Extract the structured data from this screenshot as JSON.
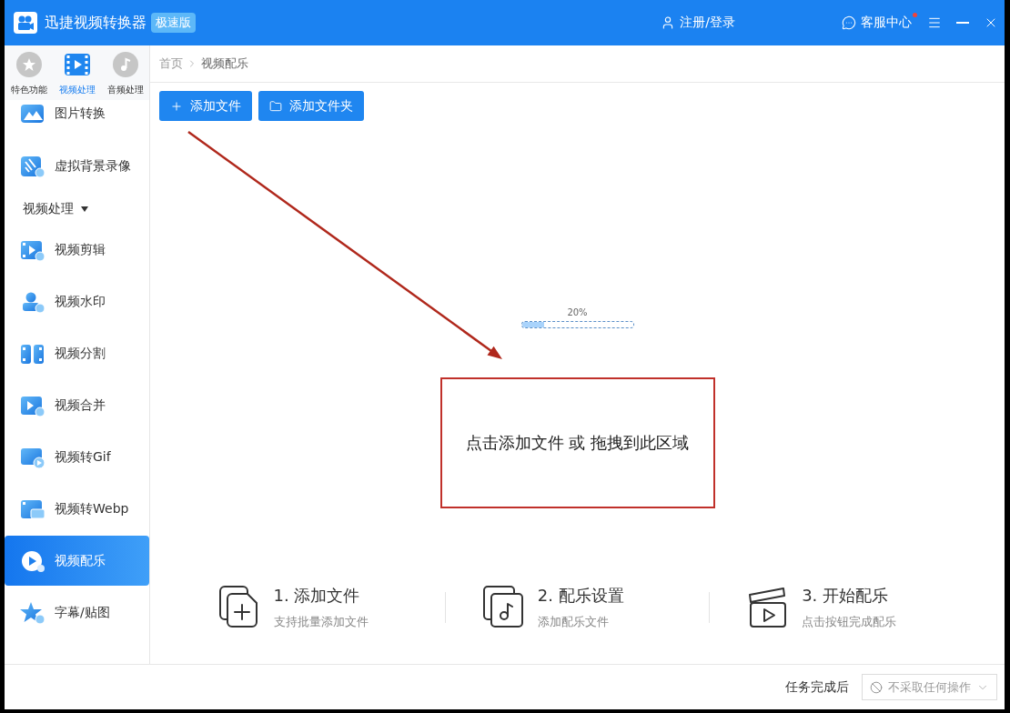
{
  "window": {
    "title": "迅捷视频转换器",
    "badge": "极速版"
  },
  "header": {
    "account": "注册/登录",
    "service": {
      "label": "客服中心",
      "notification": true
    }
  },
  "sidebar": {
    "tabs": [
      {
        "label": "特色功能",
        "selected": false
      },
      {
        "label": "视频处理",
        "selected": true
      },
      {
        "label": "音频处理",
        "selected": false
      }
    ],
    "groups": [
      {
        "items": [
          {
            "label": "图片转换",
            "selected": false
          },
          {
            "label": "虚拟背景录像",
            "selected": false
          }
        ]
      },
      {
        "title": "视频处理",
        "expanded": true,
        "items": [
          {
            "label": "视频剪辑",
            "selected": false
          },
          {
            "label": "视频水印",
            "selected": false
          },
          {
            "label": "视频分割",
            "selected": false
          },
          {
            "label": "视频合并",
            "selected": false
          },
          {
            "label": "视频转Gif",
            "selected": false
          },
          {
            "label": "视频转Webp",
            "selected": false
          },
          {
            "label": "视频配乐",
            "selected": true
          },
          {
            "label": "字幕/贴图",
            "selected": false
          }
        ]
      }
    ]
  },
  "breadcrumb": [
    "首页",
    "视频配乐"
  ],
  "toolbar": [
    {
      "label": "添加文件",
      "kind": "file"
    },
    {
      "label": "添加文件夹",
      "kind": "folder"
    }
  ],
  "progress": {
    "reading": "20%",
    "level": 0.2
  },
  "drop_zone": {
    "text": "点击添加文件 或 拖拽到此区域"
  },
  "steps": [
    {
      "title": "1. 添加文件",
      "subtitle": "支持批量添加文件",
      "kind": "file"
    },
    {
      "title": "2. 配乐设置",
      "subtitle": "添加配乐文件",
      "kind": "music"
    },
    {
      "title": "3. 开始配乐",
      "subtitle": "点击按钮完成配乐",
      "kind": "clapper"
    }
  ],
  "footer": {
    "label": "任务完成后",
    "select": {
      "value": "不采取任何操作"
    }
  }
}
